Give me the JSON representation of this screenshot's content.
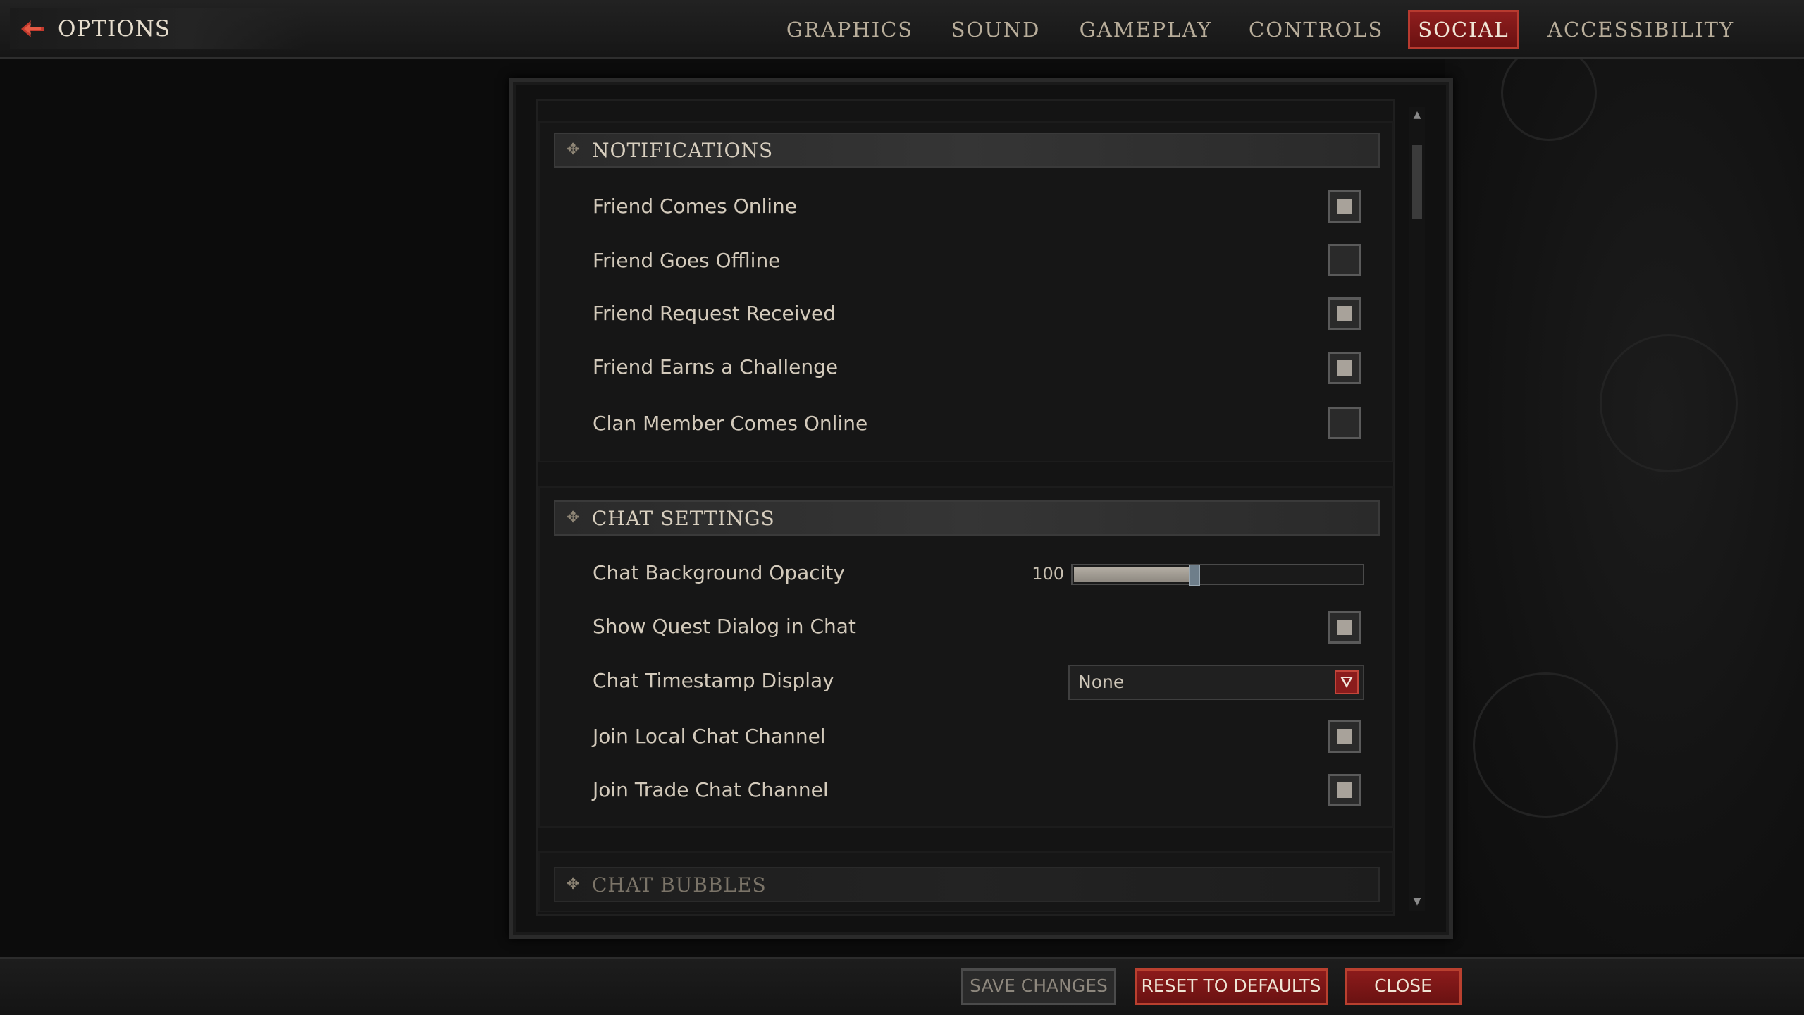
{
  "app": {
    "title": "OPTIONS"
  },
  "tabs": [
    {
      "label": "GRAPHICS",
      "active": false
    },
    {
      "label": "SOUND",
      "active": false
    },
    {
      "label": "GAMEPLAY",
      "active": false
    },
    {
      "label": "CONTROLS",
      "active": false
    },
    {
      "label": "SOCIAL",
      "active": true
    },
    {
      "label": "ACCESSIBILITY",
      "active": false
    }
  ],
  "notifications": {
    "title": "NOTIFICATIONS",
    "items": [
      {
        "label": "Friend Comes Online",
        "checked": true
      },
      {
        "label": "Friend Goes Offline",
        "checked": false
      },
      {
        "label": "Friend Request Received",
        "checked": true
      },
      {
        "label": "Friend Earns a Challenge",
        "checked": true
      },
      {
        "label": "Clan Member Comes Online",
        "checked": false
      }
    ]
  },
  "chat": {
    "title": "CHAT SETTINGS",
    "opacity": {
      "label": "Chat Background Opacity",
      "value": "100",
      "fraction": 0.4
    },
    "quest_dialog": {
      "label": "Show Quest Dialog in Chat",
      "checked": true
    },
    "timestamp": {
      "label": "Chat Timestamp Display",
      "value": "None"
    },
    "local": {
      "label": "Join Local Chat Channel",
      "checked": true
    },
    "trade": {
      "label": "Join Trade Chat Channel",
      "checked": true
    }
  },
  "bubbles": {
    "title": "CHAT BUBBLES"
  },
  "footer": {
    "save": "SAVE CHANGES",
    "reset": "RESET TO DEFAULTS",
    "close": "CLOSE"
  },
  "colors": {
    "accent_red": "#8c1b1b",
    "border_red": "#b9402f"
  }
}
